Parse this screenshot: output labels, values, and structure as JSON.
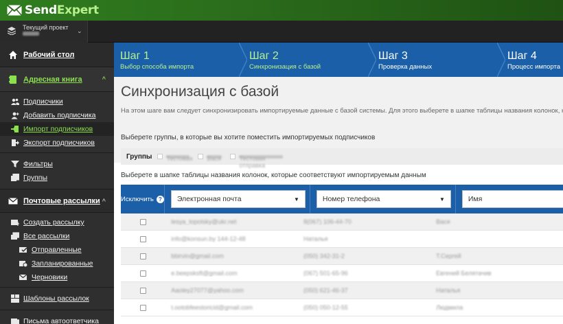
{
  "app": {
    "logo_part1": "Send",
    "logo_part2": "Expert"
  },
  "project": {
    "label": "Текущий проект",
    "caret": "⌄"
  },
  "sidebar": {
    "dashboard": "Рабочий стол",
    "address_book": "Адресная книга",
    "address_items": [
      "Подписчики",
      "Добавить подписчика",
      "Импорт подписчиков",
      "Экспорт подписчиков"
    ],
    "filters": "Фильтры",
    "groups": "Группы",
    "mailings": "Почтовые рассылки",
    "mailing_items": [
      "Создать рассылку",
      "Все рассылки"
    ],
    "mailing_sub_items": [
      "Отправленные",
      "Запланированные",
      "Черновики"
    ],
    "templates": "Шаблоны рассылок",
    "autoresponder": "Письма автоответчика",
    "chevron_up": "^",
    "chevron_up2": "^"
  },
  "steps": [
    {
      "title": "Шаг 1",
      "sub": "Выбор способа импорта"
    },
    {
      "title": "Шаг 2",
      "sub": "Синхронизация с базой"
    },
    {
      "title": "Шаг 3",
      "sub": "Проверка данных"
    },
    {
      "title": "Шаг 4",
      "sub": "Процесс импорта"
    }
  ],
  "page": {
    "title": "Синхронизация с базой",
    "description": "На этом шаге вам следует синхронизировать импортируемые данные с базой системы. Для этого выберете в шапке таблицы названия колонок, ко",
    "groups_label": "Выберете группы, в которые вы хотите поместить импортируемых подписчиков",
    "groups_tab": "Группы",
    "group_options": [
      "Тестовая",
      "Вася",
      "Тестовая отправка"
    ],
    "columns_label": "Выберете в шапке таблицы названия колонок, которые соответствуют импортируемым данным"
  },
  "grid": {
    "exclude_label": "Исключить",
    "help": "?",
    "columns": [
      "Электронная почта",
      "Номер телефона",
      "Имя"
    ],
    "caret": "▼",
    "rows": [
      [
        "lesya_topolsky@ukr.net",
        "8(067) 106-44-70",
        "Вася"
      ],
      [
        "info@konsun.by 144-12-48",
        "Наталья",
        ""
      ],
      [
        "bbirvin@gmail.com",
        "(050) 342-31-2",
        "Т.Сергей"
      ],
      [
        "e.beepsksft@gmail.com",
        "(067) 501-65-96",
        "Евгений Белятачив"
      ],
      [
        "Aaoley27077@yahoo.com",
        "(050) 621-46-37",
        "Наталья"
      ],
      [
        "t.ootobfeestoricid@gmail.com",
        "(050) 050-12-55",
        "Людмила"
      ]
    ]
  },
  "colors": {
    "brand_green": "#2f7d1e",
    "accent_green": "#8be04e",
    "step_blue": "#1b5fa8",
    "sidebar_bg": "#2b2b2b"
  }
}
